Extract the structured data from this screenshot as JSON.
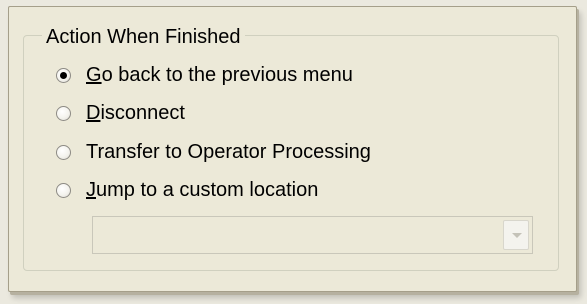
{
  "group": {
    "title": "Action When Finished"
  },
  "options": [
    {
      "label": "Go back to the previous menu",
      "mnemonic": "G",
      "rest": "o back to the previous menu",
      "checked": true
    },
    {
      "label": "Disconnect",
      "mnemonic": "D",
      "rest": "isconnect",
      "checked": false
    },
    {
      "label": "Transfer to Operator Processing",
      "mnemonic": "",
      "rest": "Transfer to Operator Processing",
      "checked": false
    },
    {
      "label": "Jump to a custom location",
      "mnemonic": "J",
      "rest": "ump to a custom location",
      "checked": false
    }
  ],
  "custom_location": {
    "value": "",
    "enabled": false
  },
  "icons": {
    "dropdown": "chevron-down-icon"
  },
  "colors": {
    "background": "#ece9d8",
    "disabled": "#c4c2b8"
  }
}
